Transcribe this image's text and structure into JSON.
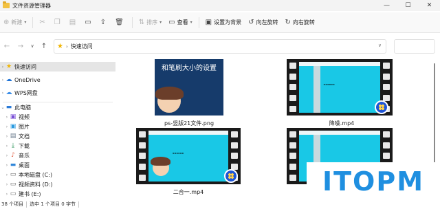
{
  "window": {
    "title": "文件资源管理器",
    "controls": [
      "—",
      "☐",
      "✕"
    ]
  },
  "commands": {
    "new_label": "新建",
    "sort_label": "排序",
    "view_label": "查看",
    "set_bg_label": "设置为背景",
    "rotate_left_label": "向左旋转",
    "rotate_right_label": "向右旋转"
  },
  "address": {
    "crumb": "快速访问"
  },
  "sidebar": {
    "quick_access": "快速访问",
    "onedrive": "OneDrive",
    "wps": "WPS网盘",
    "this_pc": "此电脑",
    "items": [
      "视频",
      "图片",
      "文档",
      "下载",
      "音乐",
      "桌面",
      "本地磁盘 (C:)",
      "视频资料 (D:)",
      "建书 (E:)"
    ]
  },
  "files": [
    {
      "name": "ps-竖版21文件.png",
      "thumb_text": "和笔刷大小的设置"
    },
    {
      "name": "降噪.mp4"
    },
    {
      "name": "二合一.mp4"
    },
    {
      "name": ""
    }
  ],
  "status": {
    "count": "38 个项目",
    "selected": "选中 1 个项目 0 字节"
  },
  "watermark": "ITOPM",
  "colors": {
    "accent": "#1f8fe0",
    "video_screen": "#19c8e6",
    "slide_bg": "#163b6b"
  }
}
